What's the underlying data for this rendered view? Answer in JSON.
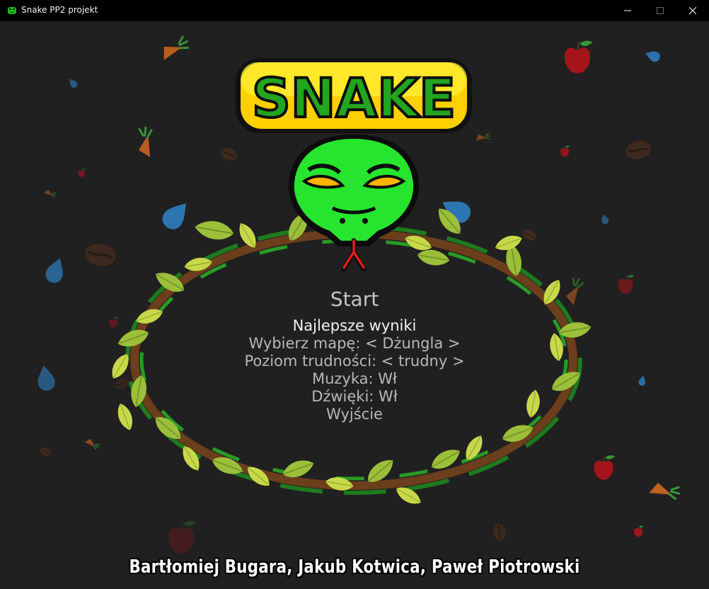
{
  "window": {
    "title": "Snake PP2 projekt",
    "titlebar_color": "#000000",
    "background_color": "#202020"
  },
  "logo": {
    "text": "SNAKE",
    "text_color": "#22a51f",
    "badge_color": "#ffd600",
    "snake_color": "#27e52e"
  },
  "menu": {
    "items": [
      {
        "label": "Start",
        "active": false
      },
      {
        "label": "Najlepsze wyniki",
        "active": true
      },
      {
        "label": "Wybierz mapę: < Dżungla >",
        "active": false
      },
      {
        "label": "Poziom trudności: < trudny >",
        "active": false
      },
      {
        "label": "Muzyka: Wł",
        "active": false
      },
      {
        "label": "Dźwięki: Wł",
        "active": false
      },
      {
        "label": "Wyjście",
        "active": false
      }
    ]
  },
  "footer": {
    "authors": "Bartłomiej Bugara, Jakub Kotwica, Paweł Piotrowski"
  }
}
